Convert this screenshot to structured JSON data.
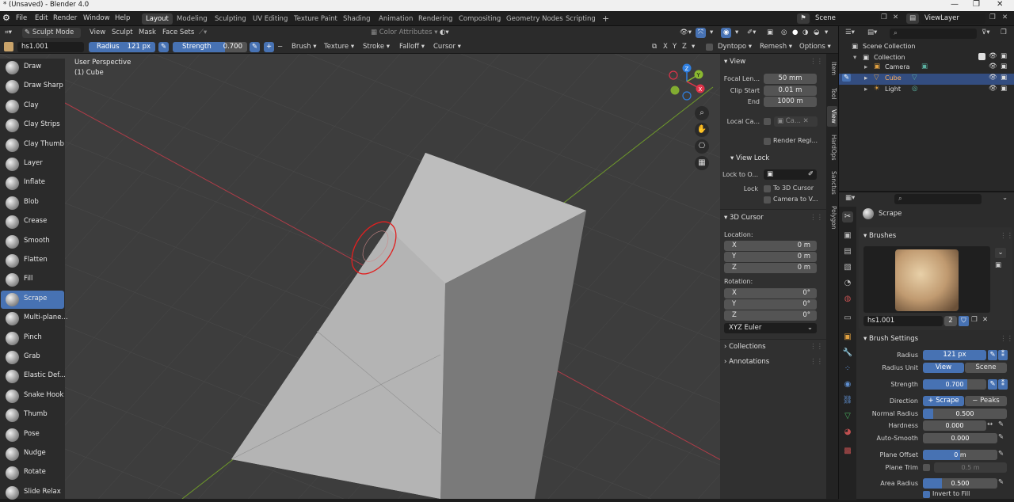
{
  "window": {
    "title": "* (Unsaved) - Blender 4.0"
  },
  "menu": {
    "items": [
      "File",
      "Edit",
      "Render",
      "Window",
      "Help"
    ]
  },
  "workspaces": [
    "Layout",
    "Modeling",
    "Sculpting",
    "UV Editing",
    "Texture Paint",
    "Shading",
    "Animation",
    "Rendering",
    "Compositing",
    "Geometry Nodes",
    "Scripting"
  ],
  "active_workspace": "Layout",
  "scene": {
    "label": "Scene",
    "view_layer": "ViewLayer"
  },
  "header": {
    "mode": "Sculpt Mode",
    "menus": [
      "View",
      "Sculpt",
      "Mask",
      "Face Sets"
    ],
    "color_attributes": "Color Attributes",
    "x": "X",
    "y": "Y",
    "z": "Z",
    "dyntopo": "Dyntopo",
    "remesh": "Remesh",
    "options": "Options"
  },
  "brush_header": {
    "name": "hs1.001",
    "radius_label": "Radius",
    "radius_value": "121 px",
    "strength_label": "Strength",
    "strength_value": "0.700",
    "menus": [
      "Brush",
      "Texture",
      "Stroke",
      "Falloff",
      "Cursor"
    ]
  },
  "viewport": {
    "perspective": "User Perspective",
    "object": "(1) Cube"
  },
  "gizmo": {
    "x": "X",
    "y": "Y",
    "z": "Z"
  },
  "tools": [
    {
      "label": "Draw"
    },
    {
      "label": "Draw Sharp"
    },
    {
      "label": "Clay"
    },
    {
      "label": "Clay Strips"
    },
    {
      "label": "Clay Thumb"
    },
    {
      "label": "Layer"
    },
    {
      "label": "Inflate"
    },
    {
      "label": "Blob"
    },
    {
      "label": "Crease"
    },
    {
      "label": "Smooth"
    },
    {
      "label": "Flatten"
    },
    {
      "label": "Fill"
    },
    {
      "label": "Scrape"
    },
    {
      "label": "Multi-plane..."
    },
    {
      "label": "Pinch"
    },
    {
      "label": "Grab"
    },
    {
      "label": "Elastic Def..."
    },
    {
      "label": "Snake Hook"
    },
    {
      "label": "Thumb"
    },
    {
      "label": "Pose"
    },
    {
      "label": "Nudge"
    },
    {
      "label": "Rotate"
    },
    {
      "label": "Slide Relax"
    }
  ],
  "active_tool": "Scrape",
  "npanel": {
    "tabs": [
      "Item",
      "Tool",
      "View",
      "HardOps",
      "Sanctus",
      "Polygon"
    ],
    "active_tab": "View",
    "view_title": "View",
    "focal_label": "Focal Len...",
    "focal_value": "50 mm",
    "clip_start_label": "Clip Start",
    "clip_start_value": "0.01 m",
    "end_label": "End",
    "end_value": "1000 m",
    "local_camera_label": "Local Ca...",
    "local_camera_value": "Ca...",
    "render_region": "Render Regi...",
    "view_lock_title": "View Lock",
    "lock_to_object_label": "Lock to O...",
    "lock_label": "Lock",
    "to_3d_cursor": "To 3D Cursor",
    "camera_to_view": "Camera to V...",
    "cursor_title": "3D Cursor",
    "location_label": "Location:",
    "loc": [
      {
        "axis": "X",
        "value": "0 m"
      },
      {
        "axis": "Y",
        "value": "0 m"
      },
      {
        "axis": "Z",
        "value": "0 m"
      }
    ],
    "rotation_label": "Rotation:",
    "rot": [
      {
        "axis": "X",
        "value": "0°"
      },
      {
        "axis": "Y",
        "value": "0°"
      },
      {
        "axis": "Z",
        "value": "0°"
      }
    ],
    "rotation_mode": "XYZ Euler",
    "collections": "Collections",
    "annotations": "Annotations"
  },
  "outliner": {
    "root": "Scene Collection",
    "collection": "Collection",
    "objects": [
      {
        "name": "Camera",
        "selected": false
      },
      {
        "name": "Cube",
        "selected": true
      },
      {
        "name": "Light",
        "selected": false
      }
    ]
  },
  "properties": {
    "brush_title": "Scrape",
    "brushes_panel": "Brushes",
    "brush_name": "hs1.001",
    "brush_users": "2",
    "settings_panel": "Brush Settings",
    "radius_label": "Radius",
    "radius_value": "121 px",
    "radius_unit_label": "Radius Unit",
    "radius_unit_view": "View",
    "radius_unit_scene": "Scene",
    "strength_label": "Strength",
    "strength_value": "0.700",
    "strength_fraction": 0.7,
    "direction_label": "Direction",
    "direction_add": "Scrape",
    "direction_sub": "Peaks",
    "normal_radius_label": "Normal Radius",
    "normal_radius_value": "0.500",
    "normal_radius_fraction": 0.5,
    "hardness_label": "Hardness",
    "hardness_value": "0.000",
    "auto_smooth_label": "Auto-Smooth",
    "auto_smooth_value": "0.000",
    "plane_offset_label": "Plane Offset",
    "plane_offset_value": "0 m",
    "plane_offset_fraction": 0.5,
    "plane_trim_label": "Plane Trim",
    "plane_trim_value": "0.5 m",
    "area_radius_label": "Area Radius",
    "area_radius_value": "0.500",
    "area_radius_fraction": 0.25,
    "invert_to_fill": "Invert to Fill"
  },
  "colors": {
    "accent": "#4772b3",
    "axis_x": "#e0344a",
    "axis_y": "#8ab830",
    "axis_z": "#2f7fe0",
    "brush_circle": "#e02020"
  }
}
